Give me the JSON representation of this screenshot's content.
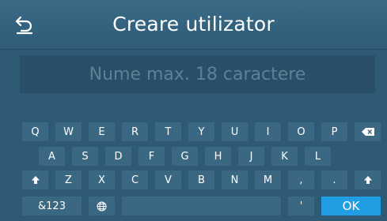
{
  "header": {
    "title": "Creare utilizator",
    "back_icon": "back-arrow-icon"
  },
  "input": {
    "placeholder": "Nume max. 18 caractere",
    "value": ""
  },
  "keyboard": {
    "row1": [
      "Q",
      "W",
      "E",
      "R",
      "T",
      "Y",
      "U",
      "I",
      "O",
      "P"
    ],
    "row2": [
      "A",
      "S",
      "D",
      "F",
      "G",
      "H",
      "J",
      "K",
      "L"
    ],
    "row3": [
      "Z",
      "X",
      "C",
      "V",
      "B",
      "N",
      "M",
      ",",
      "."
    ],
    "row4": {
      "symbols": "&123",
      "apostrophe": "'",
      "ok": "OK"
    },
    "icons": {
      "backspace": "backspace-icon",
      "shift": "shift-icon",
      "language": "globe-icon"
    }
  },
  "colors": {
    "background": "#2f5a75",
    "key": "#3a6782",
    "input": "#284f67",
    "ok_button": "#1f9ee4"
  }
}
